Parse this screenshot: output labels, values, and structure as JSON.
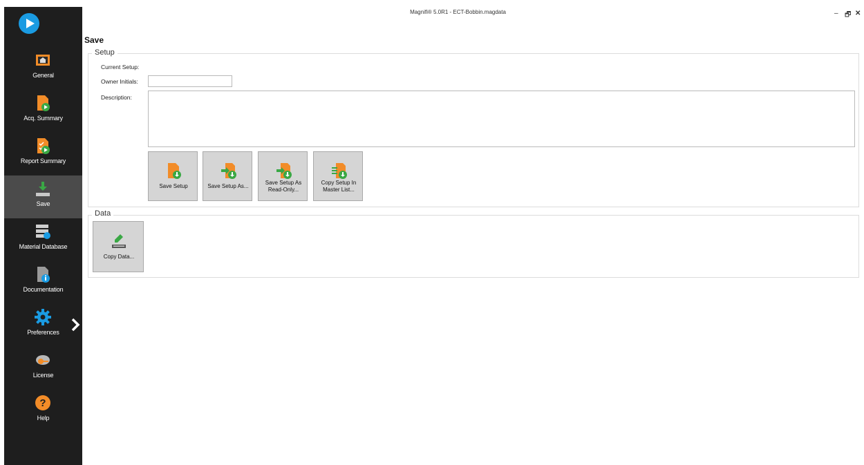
{
  "window": {
    "title": "Magnifi® 5.0R1 - ECT-Bobbin.magdata",
    "minimize": "–",
    "restore": "🗗",
    "close": "✕"
  },
  "sidebar": {
    "items": [
      {
        "label": "General",
        "icon": "home-icon"
      },
      {
        "label": "Acq. Summary",
        "icon": "acq-summary-icon"
      },
      {
        "label": "Report Summary",
        "icon": "report-summary-icon"
      },
      {
        "label": "Save",
        "icon": "save-icon",
        "active": true
      },
      {
        "label": "Material Database",
        "icon": "material-database-icon"
      },
      {
        "label": "Documentation",
        "icon": "documentation-icon"
      },
      {
        "label": "Preferences",
        "icon": "gear-icon"
      },
      {
        "label": "License",
        "icon": "license-icon"
      },
      {
        "label": "Help",
        "icon": "help-icon"
      }
    ]
  },
  "page": {
    "title": "Save"
  },
  "setup": {
    "group_label": "Setup",
    "current_setup_label": "Current Setup:",
    "owner_initials_label": "Owner Initials:",
    "owner_initials_value": "",
    "description_label": "Description:",
    "description_value": "",
    "buttons": {
      "save_setup": "Save Setup",
      "save_setup_as": "Save Setup As...",
      "save_read_only_1": "Save Setup As",
      "save_read_only_2": "Read-Only...",
      "copy_master_1": "Copy Setup In",
      "copy_master_2": "Master List..."
    }
  },
  "data": {
    "group_label": "Data",
    "copy_data": "Copy Data..."
  },
  "colors": {
    "accent_orange": "#f28c28",
    "accent_green": "#3aa845",
    "accent_blue": "#1a9be2",
    "sidebar_bg": "#1e1e1e"
  }
}
